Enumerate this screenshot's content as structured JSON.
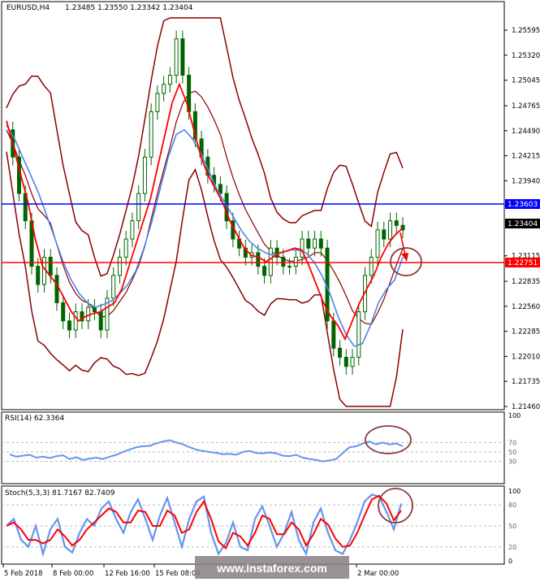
{
  "header": {
    "symbol": "EURUSD,H4",
    "ohlc": "1.23485 1.23550 1.23342 1.23404"
  },
  "watermark": "www.instaforex.com",
  "colors": {
    "bollinger": "#8b0000",
    "ma_blue": "#4a86e8",
    "ma_red": "#ff0000",
    "resistance": "#0000ff",
    "support": "#ff0000",
    "candle": "#006400",
    "rsi": "#6495ed",
    "stoch_main": "#6495ed",
    "stoch_signal": "#ff0000",
    "circle": "#8b3a3a",
    "arrow": "#ff0000"
  },
  "chart_data": [
    {
      "type": "line",
      "panel": "price",
      "price_axis": [
        "1.25595",
        "1.25320",
        "1.25045",
        "1.24765",
        "1.24490",
        "1.24215",
        "1.23940",
        "1.23665",
        "1.23115",
        "1.22835",
        "1.22560",
        "1.22285",
        "1.22010",
        "1.21735",
        "1.21460"
      ],
      "ylim": [
        1.2146,
        1.2573
      ],
      "levels": [
        {
          "name": "resistance",
          "value": "1.23603"
        },
        {
          "name": "current",
          "value": "1.23404"
        },
        {
          "name": "support",
          "value": "1.22751"
        }
      ],
      "series": [
        {
          "style": "close-line",
          "values": [
            1.245,
            1.242,
            1.238,
            1.235,
            1.23,
            1.228,
            1.231,
            1.229,
            1.226,
            1.224,
            1.223,
            1.225,
            1.224,
            1.2255,
            1.225,
            1.223,
            1.2265,
            1.229,
            1.231,
            1.233,
            1.235,
            1.238,
            1.242,
            1.247,
            1.249,
            1.25,
            1.251,
            1.255,
            1.251,
            1.247,
            1.244,
            1.242,
            1.24,
            1.239,
            1.238,
            1.235,
            1.233,
            1.232,
            1.231,
            1.2315,
            1.23,
            1.229,
            1.232,
            1.231,
            1.23,
            1.23,
            1.231,
            1.233,
            1.232,
            1.233,
            1.232,
            1.224,
            1.221,
            1.22,
            1.219,
            1.22,
            1.225,
            1.229,
            1.231,
            1.234,
            1.233,
            1.235,
            1.2345,
            1.234
          ]
        },
        {
          "style": "ma-red",
          "values": [
            1.246,
            1.243,
            1.24,
            1.237,
            1.233,
            1.23,
            1.229,
            1.228,
            1.2265,
            1.225,
            1.224,
            1.2245,
            1.2248,
            1.225,
            1.2255,
            1.226,
            1.2275,
            1.23,
            1.2325,
            1.235,
            1.2375,
            1.241,
            1.2445,
            1.248,
            1.25,
            1.248,
            1.245,
            1.242,
            1.24,
            1.2385,
            1.237,
            1.235,
            1.2335,
            1.232,
            1.2312,
            1.231,
            1.2305,
            1.231,
            1.2315,
            1.2317,
            1.232,
            1.2318,
            1.23,
            1.228,
            1.226,
            1.2245,
            1.2235,
            1.222,
            1.224,
            1.226,
            1.2275,
            1.229,
            1.231,
            1.2325,
            1.2335,
            1.2342
          ]
        },
        {
          "style": "ma-blue",
          "values": [
            1.2455,
            1.244,
            1.242,
            1.24,
            1.238,
            1.2355,
            1.233,
            1.2305,
            1.2285,
            1.227,
            1.226,
            1.2255,
            1.2258,
            1.2262,
            1.227,
            1.228,
            1.2295,
            1.232,
            1.235,
            1.2385,
            1.242,
            1.2445,
            1.245,
            1.244,
            1.2425,
            1.2405,
            1.2385,
            1.237,
            1.2355,
            1.234,
            1.2328,
            1.232,
            1.2315,
            1.2312,
            1.2315,
            1.2318,
            1.2318,
            1.2315,
            1.2305,
            1.229,
            1.227,
            1.2245,
            1.2225,
            1.2212,
            1.2215,
            1.2235,
            1.226,
            1.2275,
            1.2285,
            1.231
          ]
        }
      ]
    },
    {
      "type": "line",
      "panel": "rsi",
      "title": "RSI(14) 62.3364",
      "levels": [
        "70",
        "50",
        "30"
      ],
      "ylim": [
        0,
        100
      ],
      "values": [
        45,
        40,
        42,
        44,
        38,
        40,
        37,
        41,
        43,
        35,
        39,
        33,
        36,
        38,
        35,
        40,
        44,
        50,
        55,
        60,
        62,
        63,
        68,
        72,
        75,
        70,
        66,
        60,
        55,
        52,
        50,
        48,
        45,
        46,
        44,
        50,
        52,
        48,
        47,
        49,
        47,
        42,
        41,
        44,
        38,
        35,
        33,
        30,
        32,
        35,
        48,
        60,
        62,
        68,
        72,
        66,
        70,
        66,
        68,
        62
      ]
    },
    {
      "type": "line",
      "panel": "stochastic",
      "title": "Stoch(5,3,3) 81.7167 82.7409",
      "levels": [
        "100",
        "80",
        "50",
        "20",
        "0"
      ],
      "ylim": [
        0,
        100
      ],
      "series": [
        {
          "name": "main",
          "values": [
            50,
            60,
            30,
            20,
            50,
            10,
            45,
            60,
            20,
            12,
            40,
            60,
            50,
            75,
            85,
            60,
            40,
            70,
            88,
            60,
            30,
            65,
            90,
            55,
            20,
            60,
            85,
            92,
            40,
            10,
            25,
            55,
            20,
            15,
            60,
            78,
            50,
            20,
            40,
            70,
            30,
            10,
            55,
            75,
            40,
            15,
            10,
            30,
            55,
            85,
            95,
            92,
            70,
            45,
            82
          ]
        },
        {
          "name": "signal",
          "values": [
            50,
            55,
            45,
            30,
            30,
            25,
            30,
            45,
            35,
            22,
            30,
            45,
            55,
            65,
            75,
            70,
            55,
            55,
            72,
            70,
            50,
            50,
            72,
            65,
            40,
            45,
            70,
            85,
            60,
            28,
            18,
            40,
            35,
            22,
            40,
            65,
            60,
            38,
            38,
            55,
            45,
            22,
            38,
            60,
            52,
            32,
            20,
            22,
            40,
            65,
            88,
            93,
            82,
            58,
            72
          ]
        }
      ]
    }
  ],
  "time_axis": [
    "5 Feb 2018",
    "8 Feb 00:00",
    "12 Feb 16:00",
    "15 Feb 08:00",
    "2 Mar 00:00"
  ]
}
